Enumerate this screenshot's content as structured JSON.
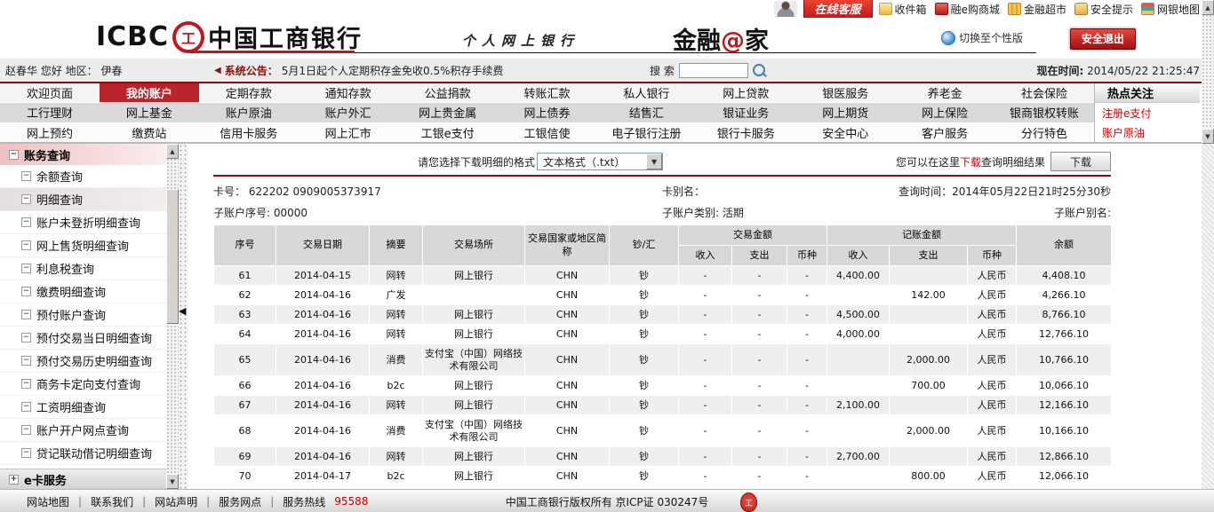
{
  "colors": {
    "accent_red": "#b8242a",
    "dark_red": "#8b0e0e",
    "link_red": "#cc0000"
  },
  "topbar": {
    "online_service": "在线客服",
    "links": [
      {
        "label": "收件箱",
        "icon": "mail-icon"
      },
      {
        "label": "融e购商城",
        "icon": "cart-icon"
      },
      {
        "label": "金融超市",
        "icon": "basket-icon"
      },
      {
        "label": "安全提示",
        "icon": "lock-icon"
      },
      {
        "label": "网银地图",
        "icon": "map-icon"
      }
    ]
  },
  "header": {
    "logo_text": "ICBC",
    "emblem_glyph": "工",
    "bank_name": "中国工商银行",
    "subtitle": "个人网上银行",
    "brand_pre": "金融",
    "brand_at": "@",
    "brand_post": "家",
    "switch_version": "切换至个性版",
    "logout": "安全退出"
  },
  "infobar": {
    "greeting": "赵春华 您好 地区： 伊春",
    "announce_label": "系统公告：",
    "announce_text": "5月1日起个人定期积存金免收0.5%积存手续费",
    "search_label": "搜 索",
    "time_label": "现在时间:",
    "time_value": "2014/05/22 21:25:47"
  },
  "nav": {
    "active": "我的账户",
    "row1": [
      "欢迎页面",
      "我的账户",
      "定期存款",
      "通知存款",
      "公益捐款",
      "转账汇款",
      "私人银行",
      "网上贷款",
      "银医服务",
      "养老金",
      "社会保险"
    ],
    "row2": [
      "工行理财",
      "网上基金",
      "账户原油",
      "账户外汇",
      "网上贵金属",
      "网上债券",
      "结售汇",
      "银证业务",
      "网上期货",
      "网上保险",
      "银商银权转账"
    ],
    "row3": [
      "网上预约",
      "缴费站",
      "信用卡服务",
      "网上汇市",
      "工银e支付",
      "工银信使",
      "电子银行注册",
      "银行卡服务",
      "安全中心",
      "客户服务",
      "分行特色"
    ],
    "hot": {
      "title": "热点关注",
      "links": [
        "注册e支付",
        "账户原油"
      ]
    }
  },
  "sidebar": {
    "group1": "账务查询",
    "selected": "明细查询",
    "items": [
      "余额查询",
      "明细查询",
      "账户未登折明细查询",
      "网上售货明细查询",
      "利息税查询",
      "缴费明细查询",
      "预付账户查询",
      "预付交易当日明细查询",
      "预付交易历史明细查询",
      "商务卡定向支付查询",
      "工资明细查询",
      "账户开户网点查询",
      "贷记联动借记明细查询"
    ],
    "group2": "e卡服务"
  },
  "content": {
    "format_label": "请您选择下载明细的格式",
    "format_value": "文本格式（.txt）",
    "download_hint_pre": "您可以在这里",
    "download_hint_red": "下载",
    "download_hint_post": "查询明细结果",
    "download_button": "下载",
    "card_no_label": "卡号：",
    "card_no": "622202 0909005373917",
    "card_alias_label": "卡别名：",
    "query_time_label": "查询时间：",
    "query_time": "2014年05月22日21时25分30秒",
    "sub_seq_label": "子账户序号:",
    "sub_seq": "00000",
    "sub_type_label": "子账户类别:",
    "sub_type": "活期",
    "sub_alias_label": "子账户别名:"
  },
  "table": {
    "headers": {
      "seq": "序号",
      "date": "交易日期",
      "summary": "摘要",
      "place": "交易场所",
      "country": "交易国家或地区简称",
      "cash": "钞/汇",
      "trade": "交易金额",
      "book": "记账金额",
      "income": "收入",
      "expense": "支出",
      "currency": "币种",
      "balance": "余额"
    },
    "rows": [
      [
        "61",
        "2014-04-15",
        "网转",
        "网上银行",
        "CHN",
        "钞",
        "-",
        "-",
        "-",
        "4,400.00",
        "",
        "人民币",
        "4,408.10"
      ],
      [
        "62",
        "2014-04-16",
        "广发",
        "",
        "CHN",
        "钞",
        "-",
        "-",
        "-",
        "",
        "142.00",
        "人民币",
        "4,266.10"
      ],
      [
        "63",
        "2014-04-16",
        "网转",
        "网上银行",
        "CHN",
        "钞",
        "-",
        "-",
        "-",
        "4,500.00",
        "",
        "人民币",
        "8,766.10"
      ],
      [
        "64",
        "2014-04-16",
        "网转",
        "网上银行",
        "CHN",
        "钞",
        "-",
        "-",
        "-",
        "4,000.00",
        "",
        "人民币",
        "12,766.10"
      ],
      [
        "65",
        "2014-04-16",
        "消费",
        "支付宝（中国）网络技术有限公司",
        "CHN",
        "钞",
        "-",
        "-",
        "-",
        "",
        "2,000.00",
        "人民币",
        "10,766.10"
      ],
      [
        "66",
        "2014-04-16",
        "b2c",
        "网上银行",
        "CHN",
        "钞",
        "-",
        "-",
        "-",
        "",
        "700.00",
        "人民币",
        "10,066.10"
      ],
      [
        "67",
        "2014-04-16",
        "网转",
        "网上银行",
        "CHN",
        "钞",
        "-",
        "-",
        "-",
        "2,100.00",
        "",
        "人民币",
        "12,166.10"
      ],
      [
        "68",
        "2014-04-16",
        "消费",
        "支付宝（中国）网络技术有限公司",
        "CHN",
        "钞",
        "-",
        "-",
        "-",
        "",
        "2,000.00",
        "人民币",
        "10,166.10"
      ],
      [
        "69",
        "2014-04-16",
        "网转",
        "网上银行",
        "CHN",
        "钞",
        "-",
        "-",
        "-",
        "2,700.00",
        "",
        "人民币",
        "12,866.10"
      ],
      [
        "70",
        "2014-04-17",
        "b2c",
        "网上银行",
        "CHN",
        "钞",
        "-",
        "-",
        "-",
        "",
        "800.00",
        "人民币",
        "12,066.10"
      ]
    ]
  },
  "footer": {
    "links": [
      "网站地图",
      "联系我们",
      "网站声明",
      "服务网点"
    ],
    "hotline_label": "服务热线",
    "hotline": "95588",
    "copyright": "中国工商银行版权所有  京ICP证 030247号",
    "seal_glyph": "工"
  },
  "scrollbar": {
    "up": "▲",
    "down": "▼",
    "collapse": "◀"
  }
}
